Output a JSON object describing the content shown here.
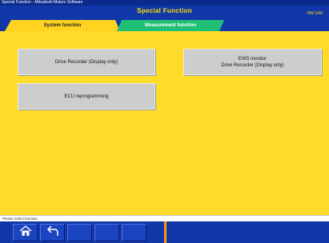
{
  "window": {
    "title": "Special Function - Mitsubishi Motors Software"
  },
  "header": {
    "title": "Special Function",
    "code": "HW 1/40"
  },
  "tabs": [
    {
      "label": "System function",
      "active": true
    },
    {
      "label": "Measurement function",
      "active": false
    }
  ],
  "buttons": {
    "drive_recorder": "Drive Recorder (Display only)",
    "ecu_reprogramming": "ECU reprogramming",
    "ews_line1": "EWS monitor",
    "ews_line2": "Drive Recorder (Display only)"
  },
  "status": {
    "text": "Please select function"
  },
  "nav": {
    "items": [
      {
        "icon": "home-icon"
      },
      {
        "icon": "return-icon"
      },
      {
        "icon": ""
      },
      {
        "icon": ""
      },
      {
        "icon": ""
      }
    ]
  },
  "colors": {
    "header_blue": "#1237a8",
    "content_yellow": "#ffdc2a",
    "title_yellow": "#ffe000",
    "tab_green": "#1fbf76",
    "button_gray": "#cdcdcd"
  }
}
